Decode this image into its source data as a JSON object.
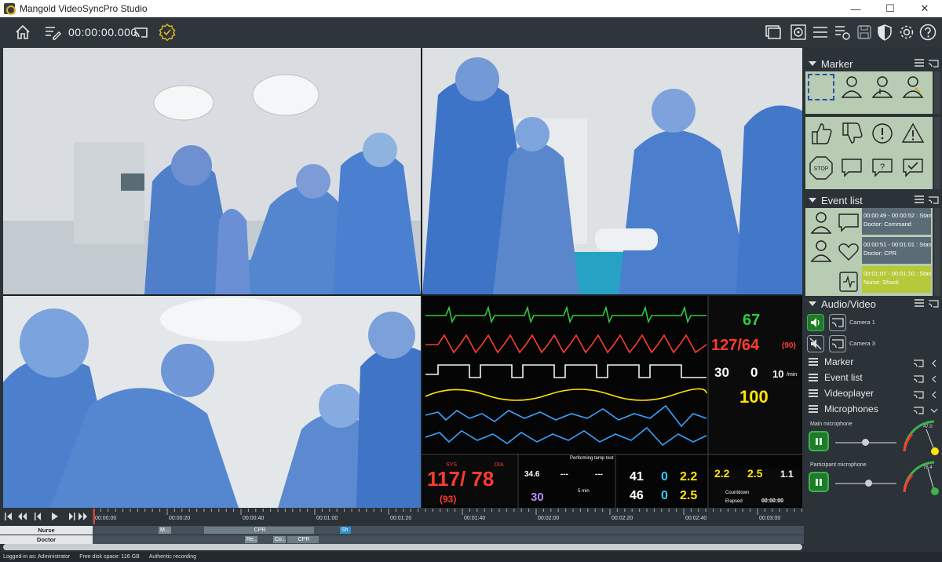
{
  "window": {
    "title": "Mangold VideoSyncPro Studio",
    "minimize": "—",
    "maximize": "☐",
    "close": "✕"
  },
  "toolbar": {
    "timecode": "00:00:00.000",
    "icons": [
      "home-icon",
      "edit-list-icon",
      "cast-icon",
      "certified-badge-icon",
      "layout-icon",
      "stopwatch-settings-icon",
      "menu-icon",
      "checklist-icon",
      "save-icon",
      "shield-icon",
      "gear-icon",
      "help-icon"
    ]
  },
  "monitor": {
    "hr": "67",
    "abp": "127/64",
    "abp_mean": "(90)",
    "et": "30",
    "fi": "0",
    "rr": "10",
    "rr_unit": "/min",
    "spo2": "100",
    "nbp": "117/ 78",
    "nbp_mean": "(93)",
    "t1": "34.6",
    "t2": "---",
    "t3": "---",
    "temp_val": "30",
    "co2_et": "41",
    "co2_fi": "46",
    "n2o_et": "0",
    "n2o_fi": "0",
    "sev_et": "2.2",
    "sev_fi": "2.5",
    "agent_et": "2.2",
    "agent_fi": "2.5",
    "mac": "1.1",
    "countdown_label": "Countdown",
    "elapsed_label": "Elapsed",
    "elapsed": "00:00:00",
    "temp_title": "Performing temp test",
    "five_min": "5 min",
    "sys_label": "SYS",
    "dia_label": "DIA"
  },
  "panels": {
    "marker": {
      "title": "Marker"
    },
    "event_list": {
      "title": "Event list",
      "events": [
        {
          "time": "00:00:49 - 00:00:52 : Stanc",
          "text": "Doctor: Command"
        },
        {
          "time": "00:00:51 - 00:01:01 : Stanc",
          "text": "Doctor: CPR"
        },
        {
          "time": "00:01:07 - 00:01:10 : Stanc",
          "text": "Nurse: Shock"
        }
      ]
    },
    "audio_video": {
      "title": "Audio/Video",
      "cameras": [
        "Camera 1",
        "Camera 3"
      ],
      "sections": [
        "Marker",
        "Event list",
        "Videoplayer",
        "Microphones"
      ],
      "microphones": [
        {
          "label": "Main microphone",
          "level": 0.45,
          "gauge": "47.0"
        },
        {
          "label": "Participant microphone",
          "level": 0.5,
          "gauge": "78.4"
        }
      ]
    }
  },
  "timeline": {
    "ticks": [
      "00:00:00",
      "00:00:20",
      "00:00:40",
      "00:01:00",
      "00:01:20",
      "00:01:40",
      "00:02:00",
      "00:02:20",
      "00:02:40",
      "00:03:00"
    ],
    "tracks": [
      {
        "name": "Nurse",
        "segments": [
          {
            "label": "M..."
          },
          {
            "label": "CPR"
          },
          {
            "label": "Sh"
          }
        ]
      },
      {
        "name": "Doctor",
        "segments": [
          {
            "label": "Re..."
          },
          {
            "label": "Co..."
          },
          {
            "label": "CPR"
          }
        ]
      }
    ]
  },
  "status": {
    "user": "Logged-in as: Administrator",
    "disk": "Free disk space: 116 GB",
    "mode": "Authentic recording"
  },
  "colors": {
    "accent_green": "#3cb44b",
    "marker_bg": "#b8cbb3",
    "event_selected": "#b5c93a",
    "monitor_green": "#2ecc40",
    "monitor_red": "#ff3b30",
    "monitor_yellow": "#ffe600",
    "monitor_cyan": "#37c8ff"
  }
}
